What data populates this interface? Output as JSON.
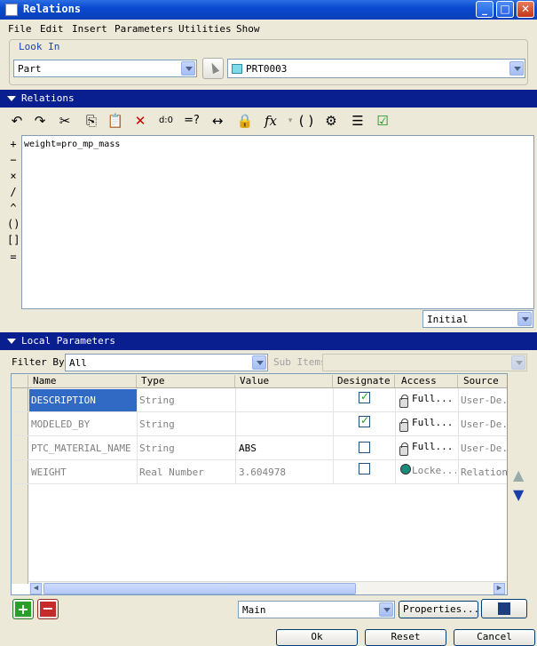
{
  "window": {
    "title": "Relations",
    "min": "_",
    "max": "□",
    "close": "✕"
  },
  "menu": [
    "File",
    "Edit",
    "Insert",
    "Parameters",
    "Utilities",
    "Show"
  ],
  "lookin": {
    "legend": "Look In",
    "type_value": "Part",
    "model_value": "PRT0003"
  },
  "relations": {
    "header": "Relations",
    "text": "weight=pro_mp_mass",
    "mode_value": "Initial"
  },
  "toolbar": [
    "undo-icon",
    "redo-icon",
    "cut-icon",
    "copy-icon",
    "paste-icon",
    "delete-icon",
    "evaluate-icon",
    "compare-icon",
    "units-icon",
    "lock-icon",
    "function-icon",
    "brackets-icon",
    "verify-icon",
    "sort-icon",
    "check-icon"
  ],
  "operators": [
    "+",
    "−",
    "×",
    "/",
    "^",
    "()",
    "[]",
    "="
  ],
  "local_params": {
    "header": "Local Parameters",
    "filter_label": "Filter By",
    "filter_value": "All",
    "subitems_label": "Sub Items",
    "columns": [
      "Name",
      "Type",
      "Value",
      "Designate",
      "Access",
      "Source"
    ],
    "rows": [
      {
        "name": "DESCRIPTION",
        "type": "String",
        "value": "",
        "designate": true,
        "access": "Full...",
        "source": "User-De..."
      },
      {
        "name": "MODELED_BY",
        "type": "String",
        "value": "",
        "designate": true,
        "access": "Full...",
        "source": "User-De..."
      },
      {
        "name": "PTC_MATERIAL_NAME",
        "type": "String",
        "value": "ABS",
        "designate": false,
        "access": "Full...",
        "source": "User-De..."
      },
      {
        "name": "WEIGHT",
        "type": "Real Number",
        "value": "3.604978",
        "designate": false,
        "access": "Locke...",
        "source": "Relation"
      }
    ],
    "main_value": "Main",
    "properties_label": "Properties..."
  },
  "buttons": {
    "ok": "Ok",
    "reset": "Reset",
    "cancel": "Cancel"
  }
}
